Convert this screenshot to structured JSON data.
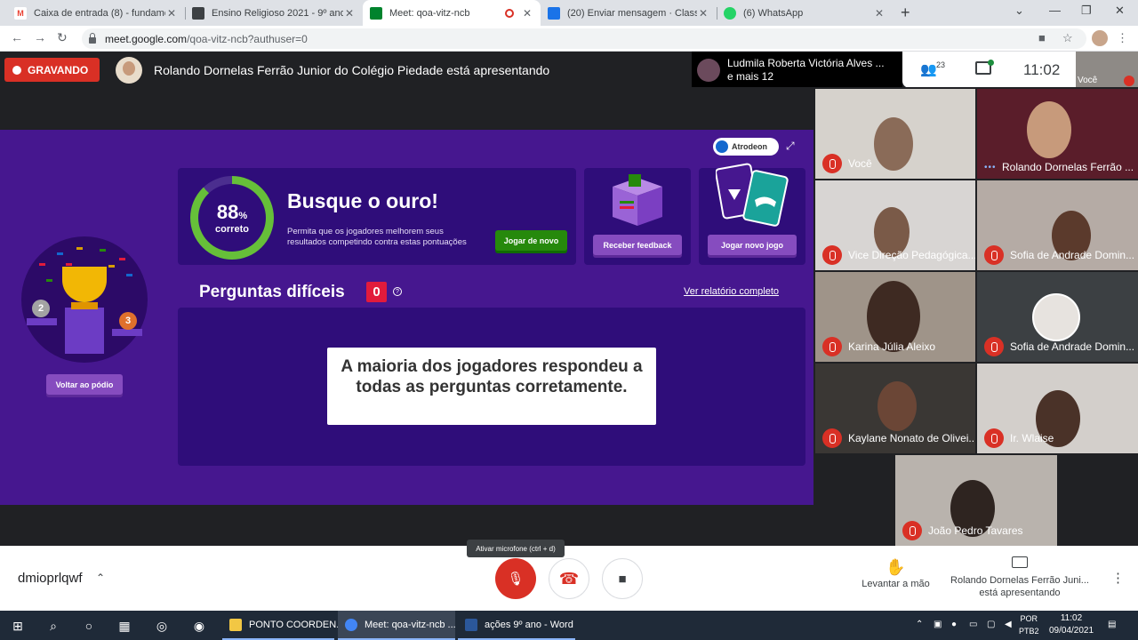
{
  "browser": {
    "tabs": [
      {
        "title": "Caixa de entrada (8) - fundament",
        "favicon": "gmail-icon",
        "color": "#ea4335",
        "glyph": "M"
      },
      {
        "title": "Ensino Religioso 2021 - 9º ano d",
        "favicon": "classroom-icon",
        "color": "#3c4043",
        "glyph": "▤"
      },
      {
        "title": "Meet: qoa-vitz-ncb",
        "favicon": "meet-icon",
        "color": "#00832d",
        "glyph": "▶"
      },
      {
        "title": "(20) Enviar mensagem · ClassApp",
        "favicon": "classapp-icon",
        "color": "#1a73e8",
        "glyph": "20"
      },
      {
        "title": "(6) WhatsApp",
        "favicon": "whatsapp-icon",
        "color": "#25d366",
        "glyph": "✆"
      }
    ],
    "url_host": "meet.google.com",
    "url_path": "/qoa-vitz-ncb?authuser=0"
  },
  "meet": {
    "recording_label": "GRAVANDO",
    "presenter_text": "Rolando Dornelas Ferrão Junior do Colégio Piedade está apresentando",
    "other_presenter_line1": "Ludmila Roberta Victória Alves ...",
    "other_presenter_line2": "e mais 12",
    "participant_count": "23",
    "time": "11:02",
    "self_label": "Você"
  },
  "slide": {
    "username": "Atrodeon",
    "score_value": "88",
    "score_unit": "%",
    "score_label": "correto",
    "score_fraction": 0.88,
    "card_title": "Busque o ouro!",
    "card_desc": "Permita que os jogadores melhorem seus resultados competindo contra estas pontuações",
    "btn_play_again": "Jogar de novo",
    "btn_feedback": "Receber feedback",
    "btn_new_game": "Jogar novo jogo",
    "btn_podium": "Voltar ao pódio",
    "questions_title": "Perguntas difíceis",
    "questions_count": "0",
    "help_glyph": "?",
    "report_link": "Ver relatório completo",
    "message": "A maioria dos jogadores respondeu a todas as perguntas corretamente."
  },
  "participants": [
    {
      "name": "Você",
      "muted": true
    },
    {
      "name": "Rolando Dornelas Ferrão ...",
      "muted": false
    },
    {
      "name": "Vice Direção Pedagógica...",
      "muted": true
    },
    {
      "name": "Sofia de Andrade Domin...",
      "muted": true
    },
    {
      "name": "Karina Júlia Aleixo",
      "muted": true
    },
    {
      "name": "Sofia de Andrade Domin...",
      "muted": true
    },
    {
      "name": "Kaylane Nonato de Olivei...",
      "muted": true
    },
    {
      "name": "Ir. Wlaise",
      "muted": true
    },
    {
      "name": "João Pedro Tavares",
      "muted": true
    }
  ],
  "bottom_bar": {
    "meeting_code": "dmioprlqwf",
    "mic_tooltip": "Ativar microfone (ctrl + d)",
    "raise_hand": "Levantar a mão",
    "presenting_line1": "Rolando Dornelas Ferrão Juni...",
    "presenting_line2": "está apresentando"
  },
  "taskbar": {
    "apps": [
      {
        "label": "PONTO COORDEN...",
        "color": "#f2c744"
      },
      {
        "label": "Meet: qoa-vitz-ncb ...",
        "color": "#4285f4"
      },
      {
        "label": "ações 9º ano - Word",
        "color": "#2b579a"
      }
    ],
    "lang1": "POR",
    "lang2": "PTB2",
    "clock_time": "11:02",
    "clock_date": "09/04/2021"
  }
}
